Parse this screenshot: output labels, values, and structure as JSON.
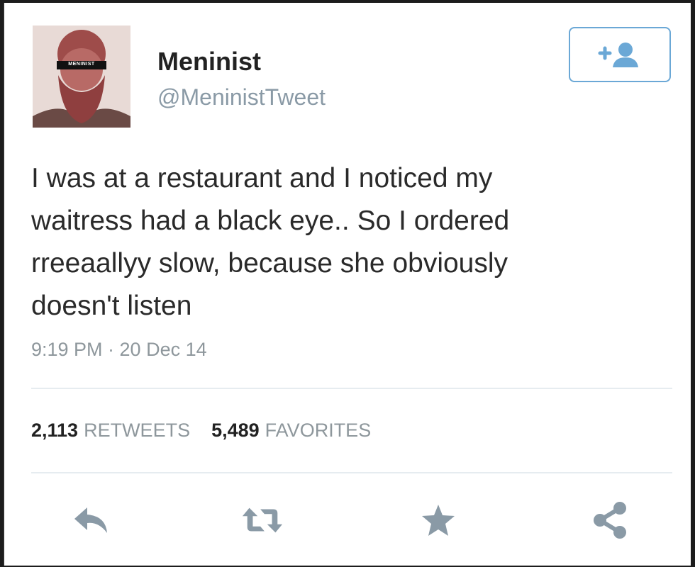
{
  "tweet": {
    "author_name": "Meninist",
    "author_handle": "@MeninistTweet",
    "avatar_label": "MENINIST",
    "text": "I was at a restaurant and I noticed my\nwaitress had a black eye.. So I ordered\nrreeaallyy slow, because she obviously\ndoesn't listen",
    "timestamp": "9:19 PM · 20 Dec 14",
    "retweets_count": "2,113",
    "retweets_label": "RETWEETS",
    "favorites_count": "5,489",
    "favorites_label": "FAVORITES"
  },
  "actions": {
    "follow_icon": "follow-person-plus-icon",
    "reply_icon": "reply-icon",
    "retweet_icon": "retweet-icon",
    "favorite_icon": "star-icon",
    "share_icon": "share-icon"
  },
  "colors": {
    "accent": "#6ba8d6",
    "icon_gray": "#8a9aa6",
    "text": "#2a2a2a",
    "muted": "#8e979c"
  }
}
